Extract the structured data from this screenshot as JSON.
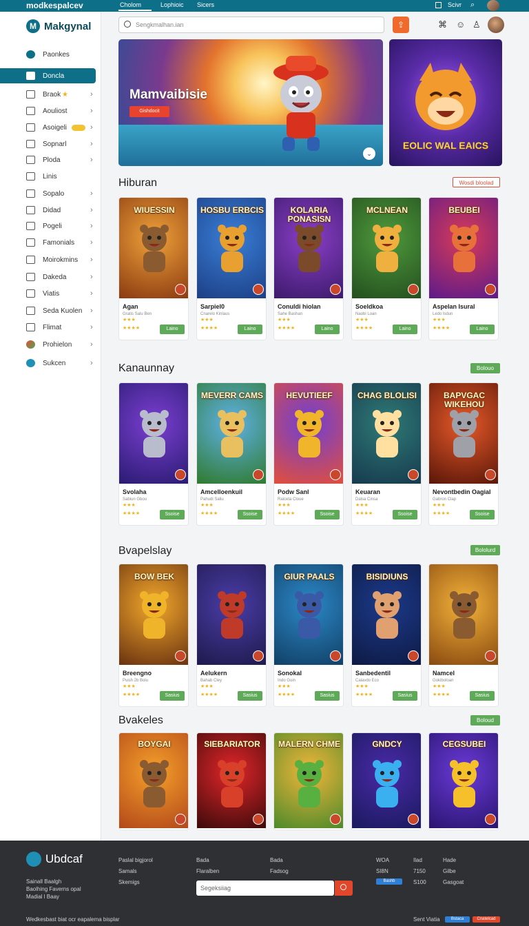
{
  "topbar": {
    "brand": "modkespalcev",
    "links": [
      "Cholom",
      "Lophioic",
      "Sicers"
    ],
    "right": "Scivr"
  },
  "sidebar": {
    "logo": "Makgynal",
    "items": [
      {
        "label": "Paonkes"
      },
      {
        "label": "Doncla"
      },
      {
        "label": "Braok"
      },
      {
        "label": "Aouliost"
      },
      {
        "label": "Asoigeli"
      },
      {
        "label": "Sopnarl"
      },
      {
        "label": "Ploda"
      },
      {
        "label": "Linis"
      },
      {
        "label": "Sopalo"
      },
      {
        "label": "Didad"
      },
      {
        "label": "Pogeli"
      },
      {
        "label": "Famonials"
      },
      {
        "label": "Moirokmins"
      },
      {
        "label": "Dakeda"
      },
      {
        "label": "Viatis"
      },
      {
        "label": "Seda Kuolen"
      },
      {
        "label": "Flimat"
      },
      {
        "label": "Prohielon"
      },
      {
        "label": "Sukcen"
      }
    ]
  },
  "header": {
    "search_placeholder": "Sengkmalhan.ian"
  },
  "hero": {
    "title": "Mamvaibisie",
    "button": "Gishdocit",
    "promo_title": "EOLIC WAL EAICS"
  },
  "sections": [
    {
      "title": "Hiburan",
      "pill": "Wosdi bloolad",
      "cards": [
        {
          "art": "WIUESSIN",
          "name": "Agan",
          "sub": "Gratis Salu Ben",
          "play": "Laino"
        },
        {
          "art": "HOSBU ERBCIS",
          "name": "Sarpiel0",
          "sub": "Cnarelo Kinlaus",
          "play": "Laino"
        },
        {
          "art": "KOLARIA PONASISN",
          "name": "Conuldi hiolan",
          "sub": "Sahe Bashan",
          "play": "Laino"
        },
        {
          "art": "MCLNEAN",
          "name": "Soeldkoa",
          "sub": "Naobi Loan",
          "play": "Laino"
        },
        {
          "art": "BEUBEI",
          "name": "Aspelan Isural",
          "sub": "Ledo lsdun",
          "play": "Laino"
        }
      ]
    },
    {
      "title": "Kanaunnay",
      "pill": "Bolouo",
      "cards": [
        {
          "art": "",
          "name": "Svolaha",
          "sub": "Sabiun Gbou",
          "play": "Ssoise"
        },
        {
          "art": "MEVERR CAMS",
          "name": "Amcelloenkuil",
          "sub": "Pahudi Saliu",
          "play": "Ssoise"
        },
        {
          "art": "HEVUTIEEF",
          "name": "Podw Sanl",
          "sub": "Raiceta Cloue",
          "play": "Ssoise"
        },
        {
          "art": "CHAG BLOLISI",
          "name": "Keuaran",
          "sub": "Dalsa Cinsa",
          "play": "Ssoise"
        },
        {
          "art": "BAPVGAC WIKEHOU",
          "name": "Nevontbedin Oagial",
          "sub": "Gabron Clap",
          "play": "Ssoise"
        }
      ]
    },
    {
      "title": "Bvapelslay",
      "pill": "Bololurd",
      "cards": [
        {
          "art": "BOW BEK",
          "name": "Breengno",
          "sub": "Puish 2b Bolu",
          "play": "Sasius"
        },
        {
          "art": "",
          "name": "Aelukern",
          "sub": "Bahab Cley",
          "play": "Sasius"
        },
        {
          "art": "GIUR PAALS",
          "name": "Sonokal",
          "sub": "Indo Goin",
          "play": "Sasius"
        },
        {
          "art": "BISIDIUNS",
          "name": "Sanbedentil",
          "sub": "Calavdo Eco",
          "play": "Sasius"
        },
        {
          "art": "",
          "name": "Namcel",
          "sub": "Gokiboloan",
          "play": "Sasius"
        }
      ]
    },
    {
      "title": "Bvakeles",
      "pill": "Boloud",
      "cards": [
        {
          "art": "BOYGAI",
          "name": "",
          "sub": "",
          "play": ""
        },
        {
          "art": "SIEBARIATOR",
          "name": "",
          "sub": "",
          "play": ""
        },
        {
          "art": "MALERN CHME",
          "name": "",
          "sub": "",
          "play": ""
        },
        {
          "art": "GNDCY",
          "name": "",
          "sub": "",
          "play": ""
        },
        {
          "art": "CEGSUBEI",
          "name": "",
          "sub": "",
          "play": ""
        }
      ]
    }
  ],
  "footer": {
    "logo": "Ubdcaf",
    "about": [
      "Sainall Baalgh",
      "Baolhing Faverns opal",
      "Madial l Baay"
    ],
    "col1": [
      "Paslal bigjorol",
      "Samals",
      "Skemigs"
    ],
    "col2": [
      "Bada",
      "Flaralben"
    ],
    "col3": [
      "Bada",
      "Fadsog"
    ],
    "col4": [
      "WOA",
      "SI8N"
    ],
    "col5": [
      "Ilad",
      "7150",
      "S100"
    ],
    "col6": [
      "Hade",
      "Gilbe",
      "Gasgoat"
    ],
    "search_placeholder": "Segeksiiag",
    "copyright": "Wedkesbast biat ocr eapalema bisplar",
    "right": "Sent Viatia",
    "badge1": "Bashb",
    "badge2": "Bstaca",
    "badge3": "Cnatelcad"
  }
}
